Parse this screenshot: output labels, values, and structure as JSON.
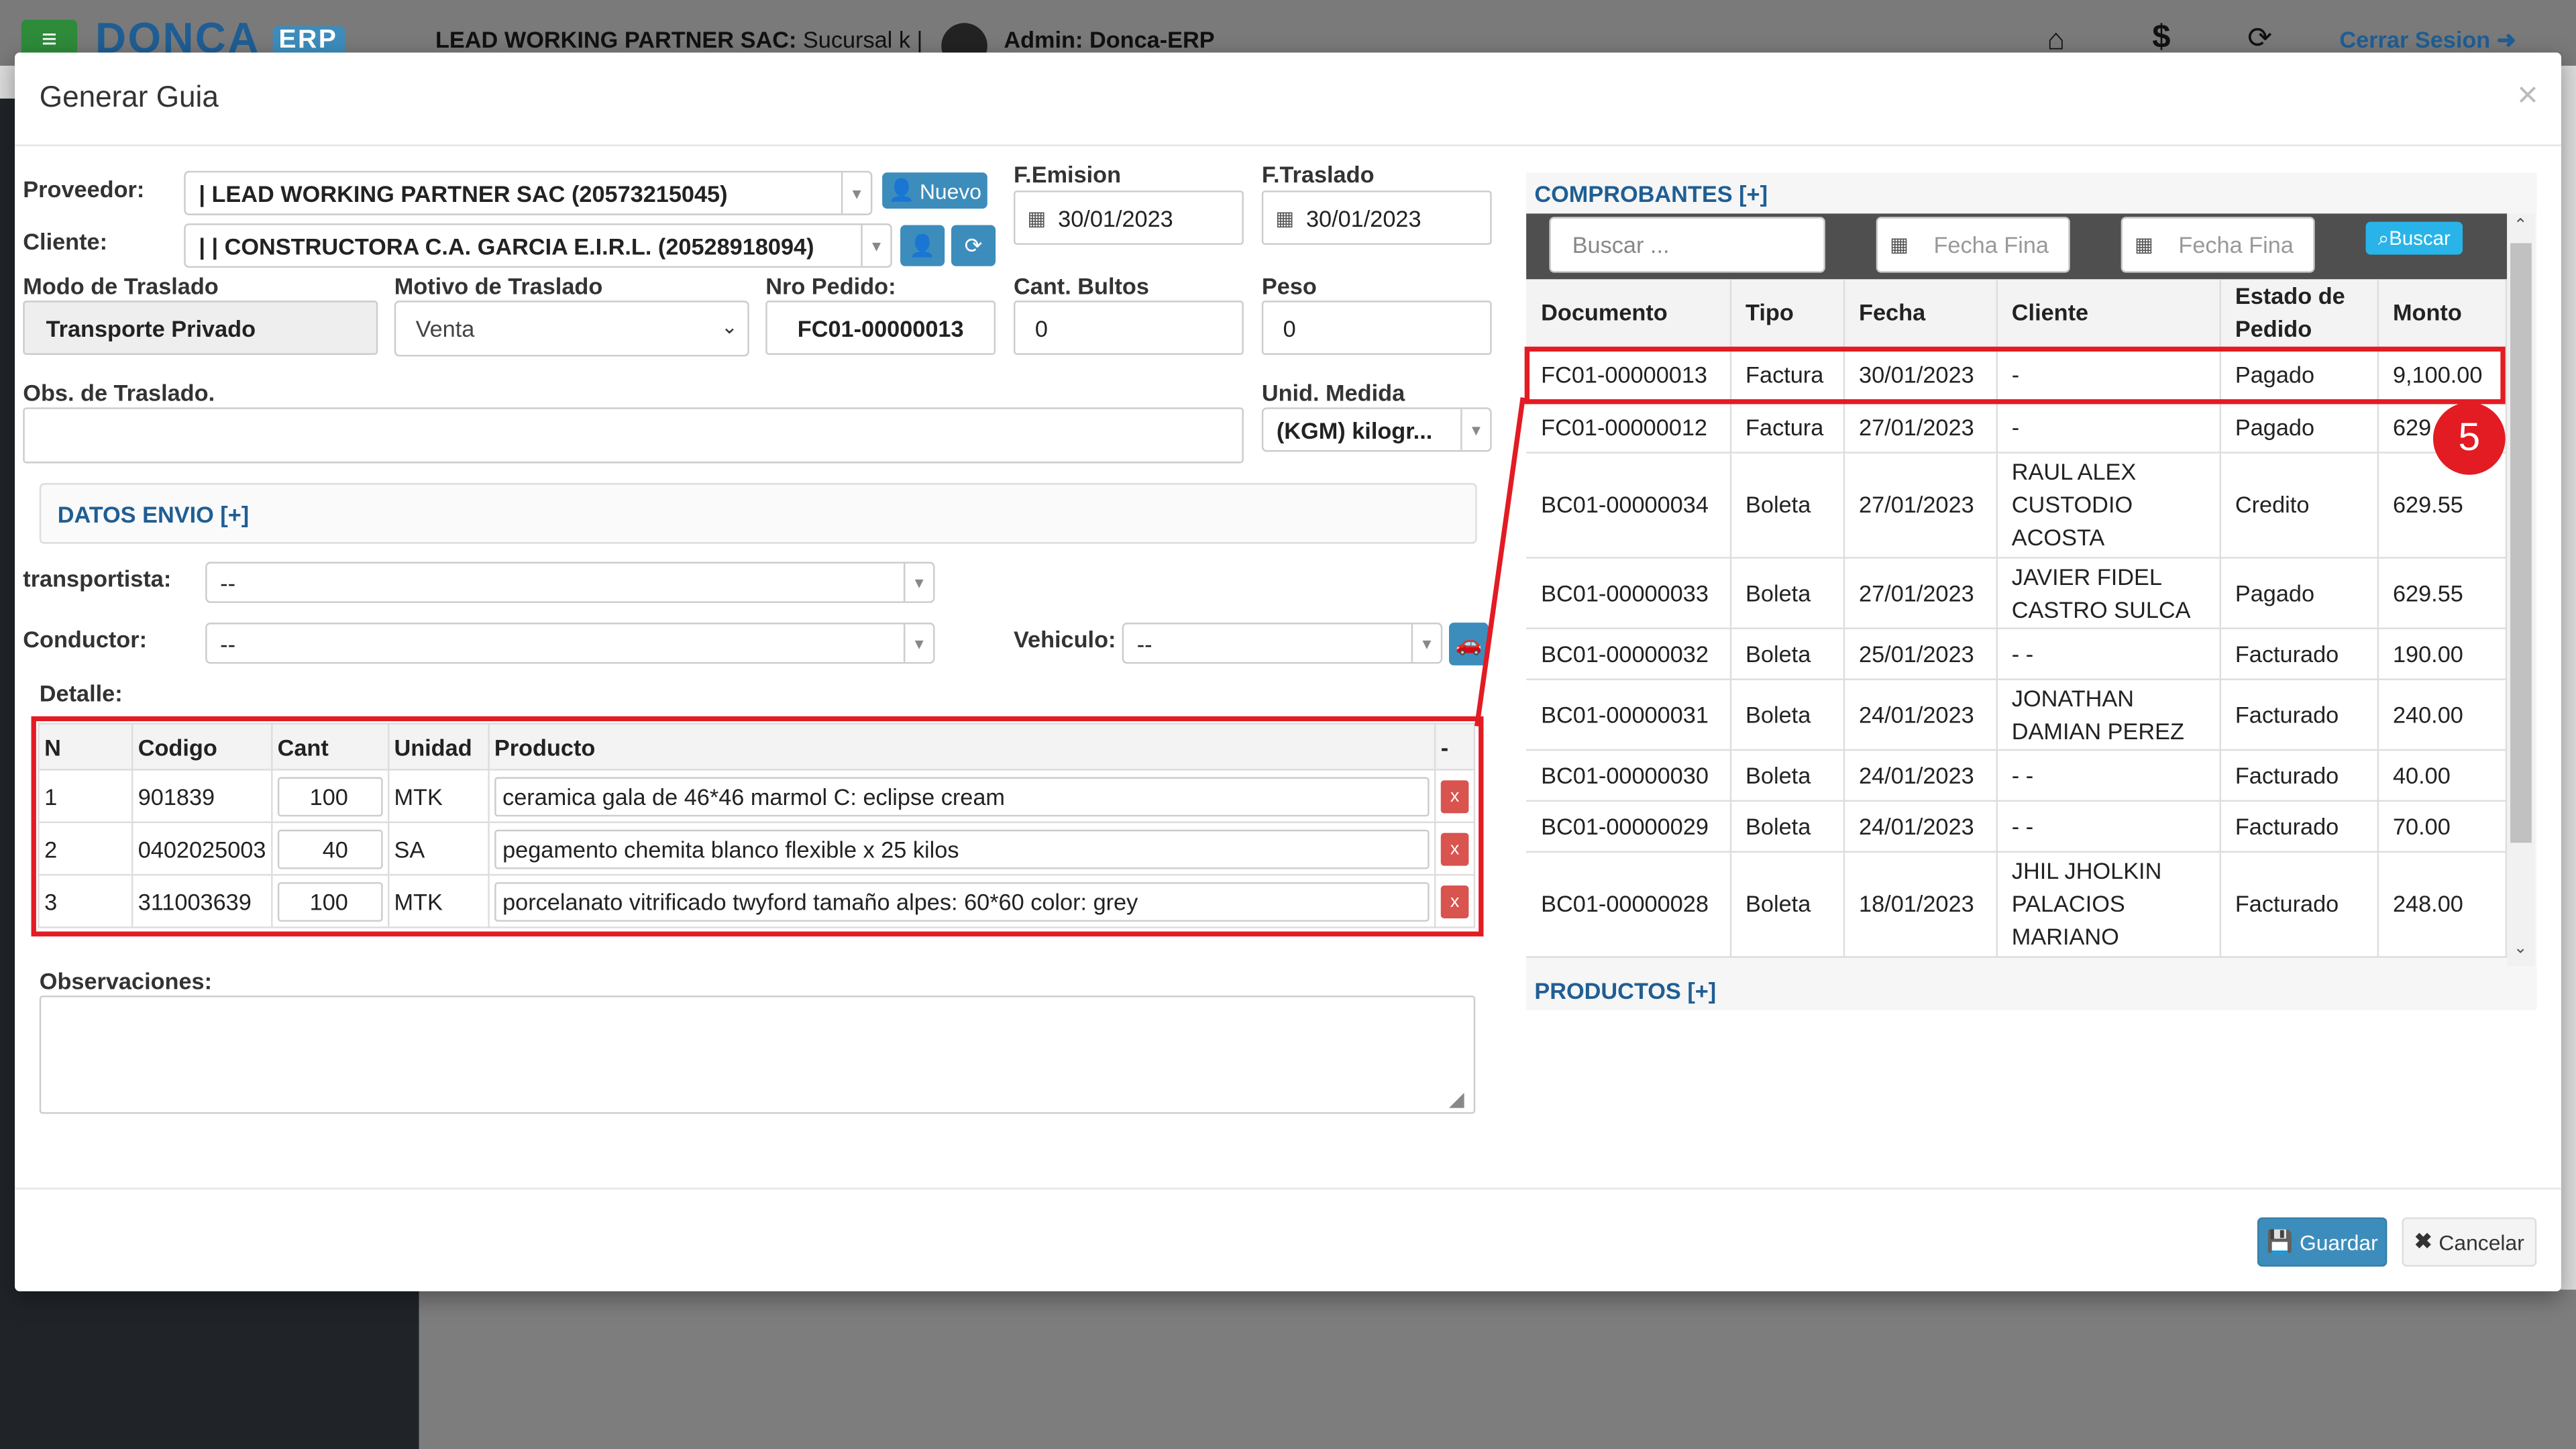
{
  "app": {
    "brand": "DONCA",
    "brand_badge": "ERP",
    "company": "LEAD WORKING PARTNER SAC:",
    "branch": "Sucursal k |",
    "user": "Admin: Donca-ERP",
    "logout": "Cerrar Sesion"
  },
  "modal": {
    "title": "Generar Guia",
    "close": "×"
  },
  "form": {
    "proveedor_label": "Proveedor:",
    "proveedor_value": "| LEAD WORKING PARTNER SAC (20573215045)",
    "nuevo_label": "Nuevo",
    "cliente_label": "Cliente:",
    "cliente_value": "| | CONSTRUCTORA C.A. GARCIA E.I.R.L. (20528918094)",
    "f_emision_label": "F.Emision",
    "f_emision_value": "30/01/2023",
    "f_traslado_label": "F.Traslado",
    "f_traslado_value": "30/01/2023",
    "modo_label": "Modo de Traslado",
    "modo_value": "Transporte Privado",
    "motivo_label": "Motivo de Traslado",
    "motivo_value": "Venta",
    "nro_pedido_label": "Nro Pedido:",
    "nro_pedido_value": "FC01-00000013",
    "cant_bultos_label": "Cant. Bultos",
    "cant_bultos_value": "0",
    "peso_label": "Peso",
    "peso_value": "0",
    "obs_traslado_label": "Obs. de Traslado.",
    "obs_traslado_value": "",
    "unid_medida_label": "Unid. Medida",
    "unid_medida_value": "(KGM) kilogr...",
    "datos_envio": "DATOS ENVIO [+]",
    "transportista_label": "transportista:",
    "transportista_value": "--",
    "conductor_label": "Conductor:",
    "conductor_value": "--",
    "vehiculo_label": "Vehiculo:",
    "vehiculo_value": "--",
    "detalle_label": "Detalle:",
    "observaciones_label": "Observaciones:",
    "observaciones_value": ""
  },
  "detail": {
    "headers": [
      "N",
      "Codigo",
      "Cant",
      "Unidad",
      "Producto",
      "-"
    ],
    "rows": [
      {
        "n": "1",
        "codigo": "901839",
        "cant": "100",
        "unidad": "MTK",
        "producto": "ceramica gala de 46*46 marmol C: eclipse cream",
        "remove": "x"
      },
      {
        "n": "2",
        "codigo": "0402025003",
        "cant": "40",
        "unidad": "SA",
        "producto": "pegamento chemita blanco flexible x 25 kilos",
        "remove": "x"
      },
      {
        "n": "3",
        "codigo": "311003639",
        "cant": "100",
        "unidad": "MTK",
        "producto": "porcelanato vitrificado twyford tamaño alpes: 60*60 color: grey",
        "remove": "x"
      }
    ]
  },
  "comprobantes": {
    "title": "COMPROBANTES [+]",
    "search_placeholder": "Buscar ...",
    "fecha_fin_placeholder_1": "Fecha Fina",
    "fecha_fin_placeholder_2": "Fecha Fina",
    "buscar_label": "Buscar",
    "headers": [
      "Documento",
      "Tipo",
      "Fecha",
      "Cliente",
      "Estado de Pedido",
      "Monto"
    ],
    "rows": [
      {
        "documento": "FC01-00000013",
        "tipo": "Factura",
        "fecha": "30/01/2023",
        "cliente": "-",
        "estado": "Pagado",
        "monto": "9,100.00"
      },
      {
        "documento": "FC01-00000012",
        "tipo": "Factura",
        "fecha": "27/01/2023",
        "cliente": "-",
        "estado": "Pagado",
        "monto": "629"
      },
      {
        "documento": "BC01-00000034",
        "tipo": "Boleta",
        "fecha": "27/01/2023",
        "cliente": "RAUL ALEX CUSTODIO ACOSTA",
        "estado": "Credito",
        "monto": "629.55"
      },
      {
        "documento": "BC01-00000033",
        "tipo": "Boleta",
        "fecha": "27/01/2023",
        "cliente": "JAVIER FIDEL CASTRO SULCA",
        "estado": "Pagado",
        "monto": "629.55"
      },
      {
        "documento": "BC01-00000032",
        "tipo": "Boleta",
        "fecha": "25/01/2023",
        "cliente": "- -",
        "estado": "Facturado",
        "monto": "190.00"
      },
      {
        "documento": "BC01-00000031",
        "tipo": "Boleta",
        "fecha": "24/01/2023",
        "cliente": "JONATHAN DAMIAN PEREZ",
        "estado": "Facturado",
        "monto": "240.00"
      },
      {
        "documento": "BC01-00000030",
        "tipo": "Boleta",
        "fecha": "24/01/2023",
        "cliente": "- -",
        "estado": "Facturado",
        "monto": "40.00"
      },
      {
        "documento": "BC01-00000029",
        "tipo": "Boleta",
        "fecha": "24/01/2023",
        "cliente": "- -",
        "estado": "Facturado",
        "monto": "70.00"
      },
      {
        "documento": "BC01-00000028",
        "tipo": "Boleta",
        "fecha": "18/01/2023",
        "cliente": "JHIL JHOLKIN PALACIOS MARIANO",
        "estado": "Facturado",
        "monto": "248.00"
      }
    ],
    "productos": "PRODUCTOS [+]"
  },
  "annotation": {
    "step": "5",
    "color": "#e31b23"
  },
  "footer": {
    "guardar": "Guardar",
    "cancelar": "Cancelar"
  },
  "colors": {
    "primary": "#3c8dbc",
    "link": "#1f5e94",
    "danger": "#d9534f",
    "highlight": "#e31b23"
  }
}
